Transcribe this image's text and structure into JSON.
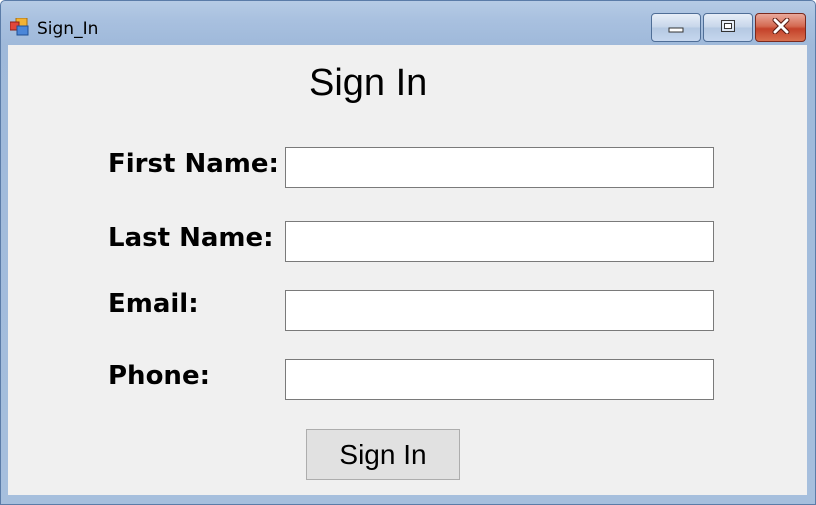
{
  "window": {
    "title": "Sign_In",
    "icon": "windows-forms-app-icon",
    "controls": {
      "minimize_icon": "minimize-icon",
      "maximize_icon": "maximize-icon",
      "close_icon": "close-icon"
    }
  },
  "form": {
    "heading": "Sign In",
    "fields": [
      {
        "label": "First Name:",
        "value": "",
        "placeholder": ""
      },
      {
        "label": "Last Name:",
        "value": "",
        "placeholder": ""
      },
      {
        "label": "Email:",
        "value": "",
        "placeholder": ""
      },
      {
        "label": "Phone:",
        "value": "",
        "placeholder": ""
      }
    ],
    "submit_label": "Sign In"
  },
  "colors": {
    "title_bar": "#a8c0df",
    "client_background": "#f0f0f0",
    "close_button": "#c4412a",
    "button_face": "#e1e1e1"
  }
}
